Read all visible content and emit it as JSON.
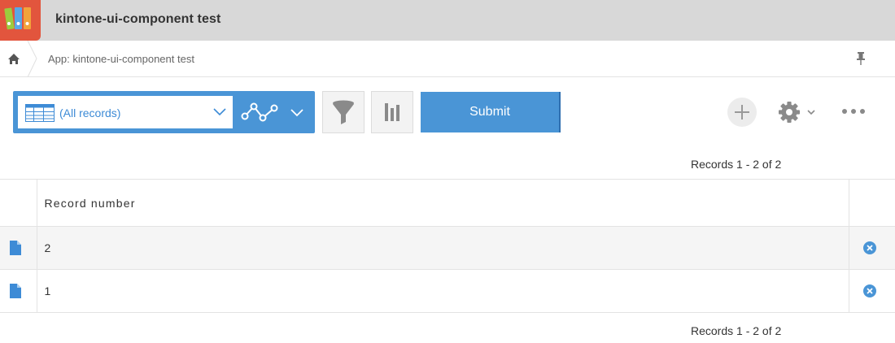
{
  "header": {
    "title": "kintone-ui-component test"
  },
  "breadcrumb": {
    "app_label": "App: kintone-ui-component test"
  },
  "toolbar": {
    "view_select_value": "(All records)",
    "submit_label": "Submit"
  },
  "records_count": {
    "top": "Records 1 - 2 of 2",
    "bottom": "Records 1 - 2 of 2"
  },
  "table": {
    "columns": [
      "Record number"
    ],
    "rows": [
      {
        "record_number": "2"
      },
      {
        "record_number": "1"
      }
    ]
  },
  "colors": {
    "accent": "#4a95d6",
    "header_bg": "#d8d8d8",
    "app_icon": "#e2553d",
    "delete_icon": "#4a95d6"
  },
  "icons": [
    "app-binders-icon",
    "home-icon",
    "pin-icon",
    "list-view-icon",
    "chevron-down-icon",
    "graph-icon",
    "funnel-icon",
    "bar-chart-icon",
    "plus-icon",
    "gear-icon",
    "more-icon",
    "document-icon",
    "delete-icon"
  ]
}
